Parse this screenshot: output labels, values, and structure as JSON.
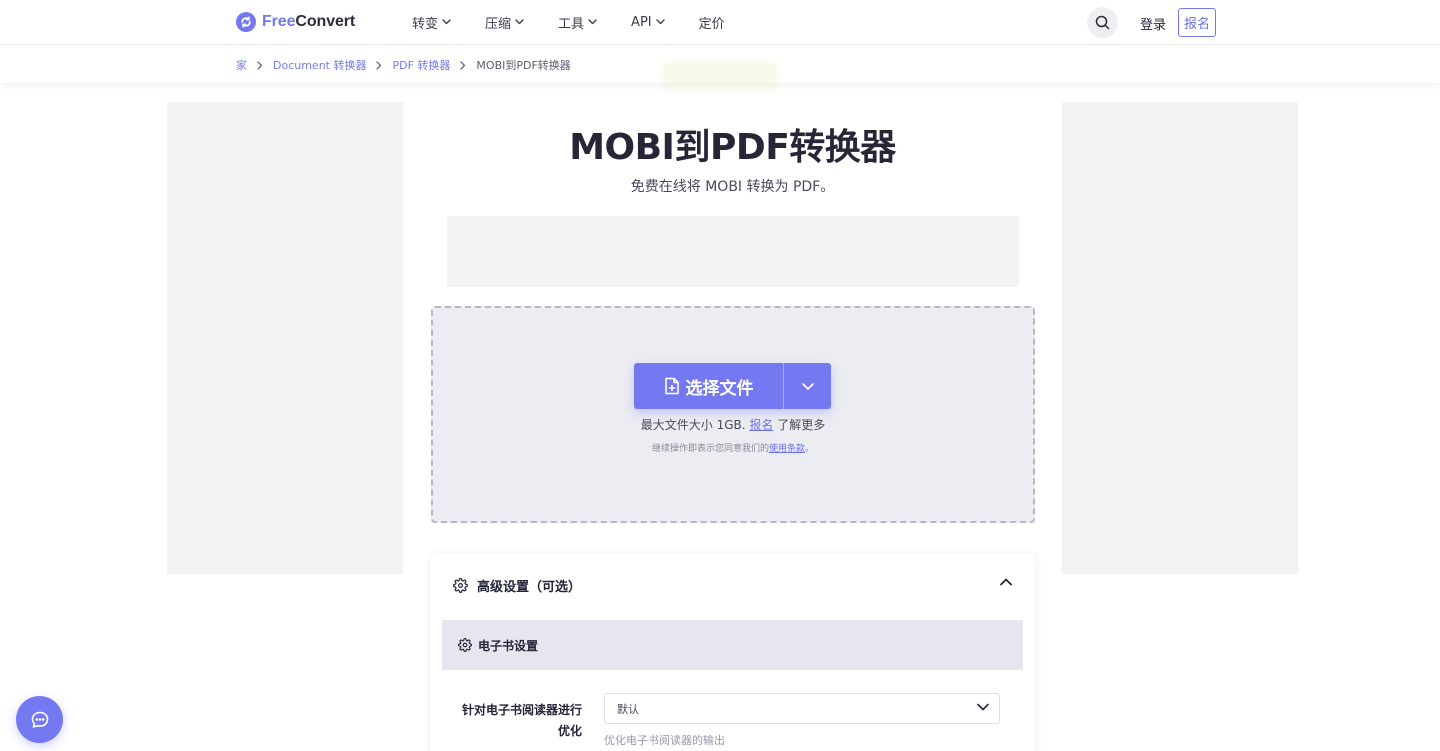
{
  "brand": {
    "logo_part1": "Free",
    "logo_part2": "Convert",
    "accent_color": "#7479f2"
  },
  "nav": {
    "items": [
      {
        "label": "转变",
        "has_dropdown": true
      },
      {
        "label": "压缩",
        "has_dropdown": true
      },
      {
        "label": "工具",
        "has_dropdown": true
      },
      {
        "label": "API",
        "has_dropdown": true
      },
      {
        "label": "定价",
        "has_dropdown": false
      }
    ],
    "search_icon": "search-icon",
    "login": "登录",
    "signup": "报名"
  },
  "breadcrumb": {
    "items": [
      "家",
      "Document 转换器",
      "PDF 转换器"
    ],
    "current": "MOBI到PDF转换器"
  },
  "hero": {
    "title": "MOBI到PDF转换器",
    "subtitle": "免费在线将 MOBI 转换为 PDF。"
  },
  "upload": {
    "choose_label": "选择文件",
    "max_size_text": "最大文件大小 1GB.",
    "max_size_link": "报名",
    "max_size_suffix": "了解更多",
    "terms_text": "继续操作即表示您同意我们的",
    "terms_link": "使用条款",
    "terms_suffix": "。"
  },
  "advanced": {
    "title": "高级设置（可选）",
    "expanded": true,
    "ebook_section": "电子书设置",
    "option_label": "针对电子书阅读器进行优化",
    "option_value": "默认",
    "option_help": "优化电子书阅读器的输出"
  },
  "chat": {
    "icon": "chat-bubble-icon"
  }
}
